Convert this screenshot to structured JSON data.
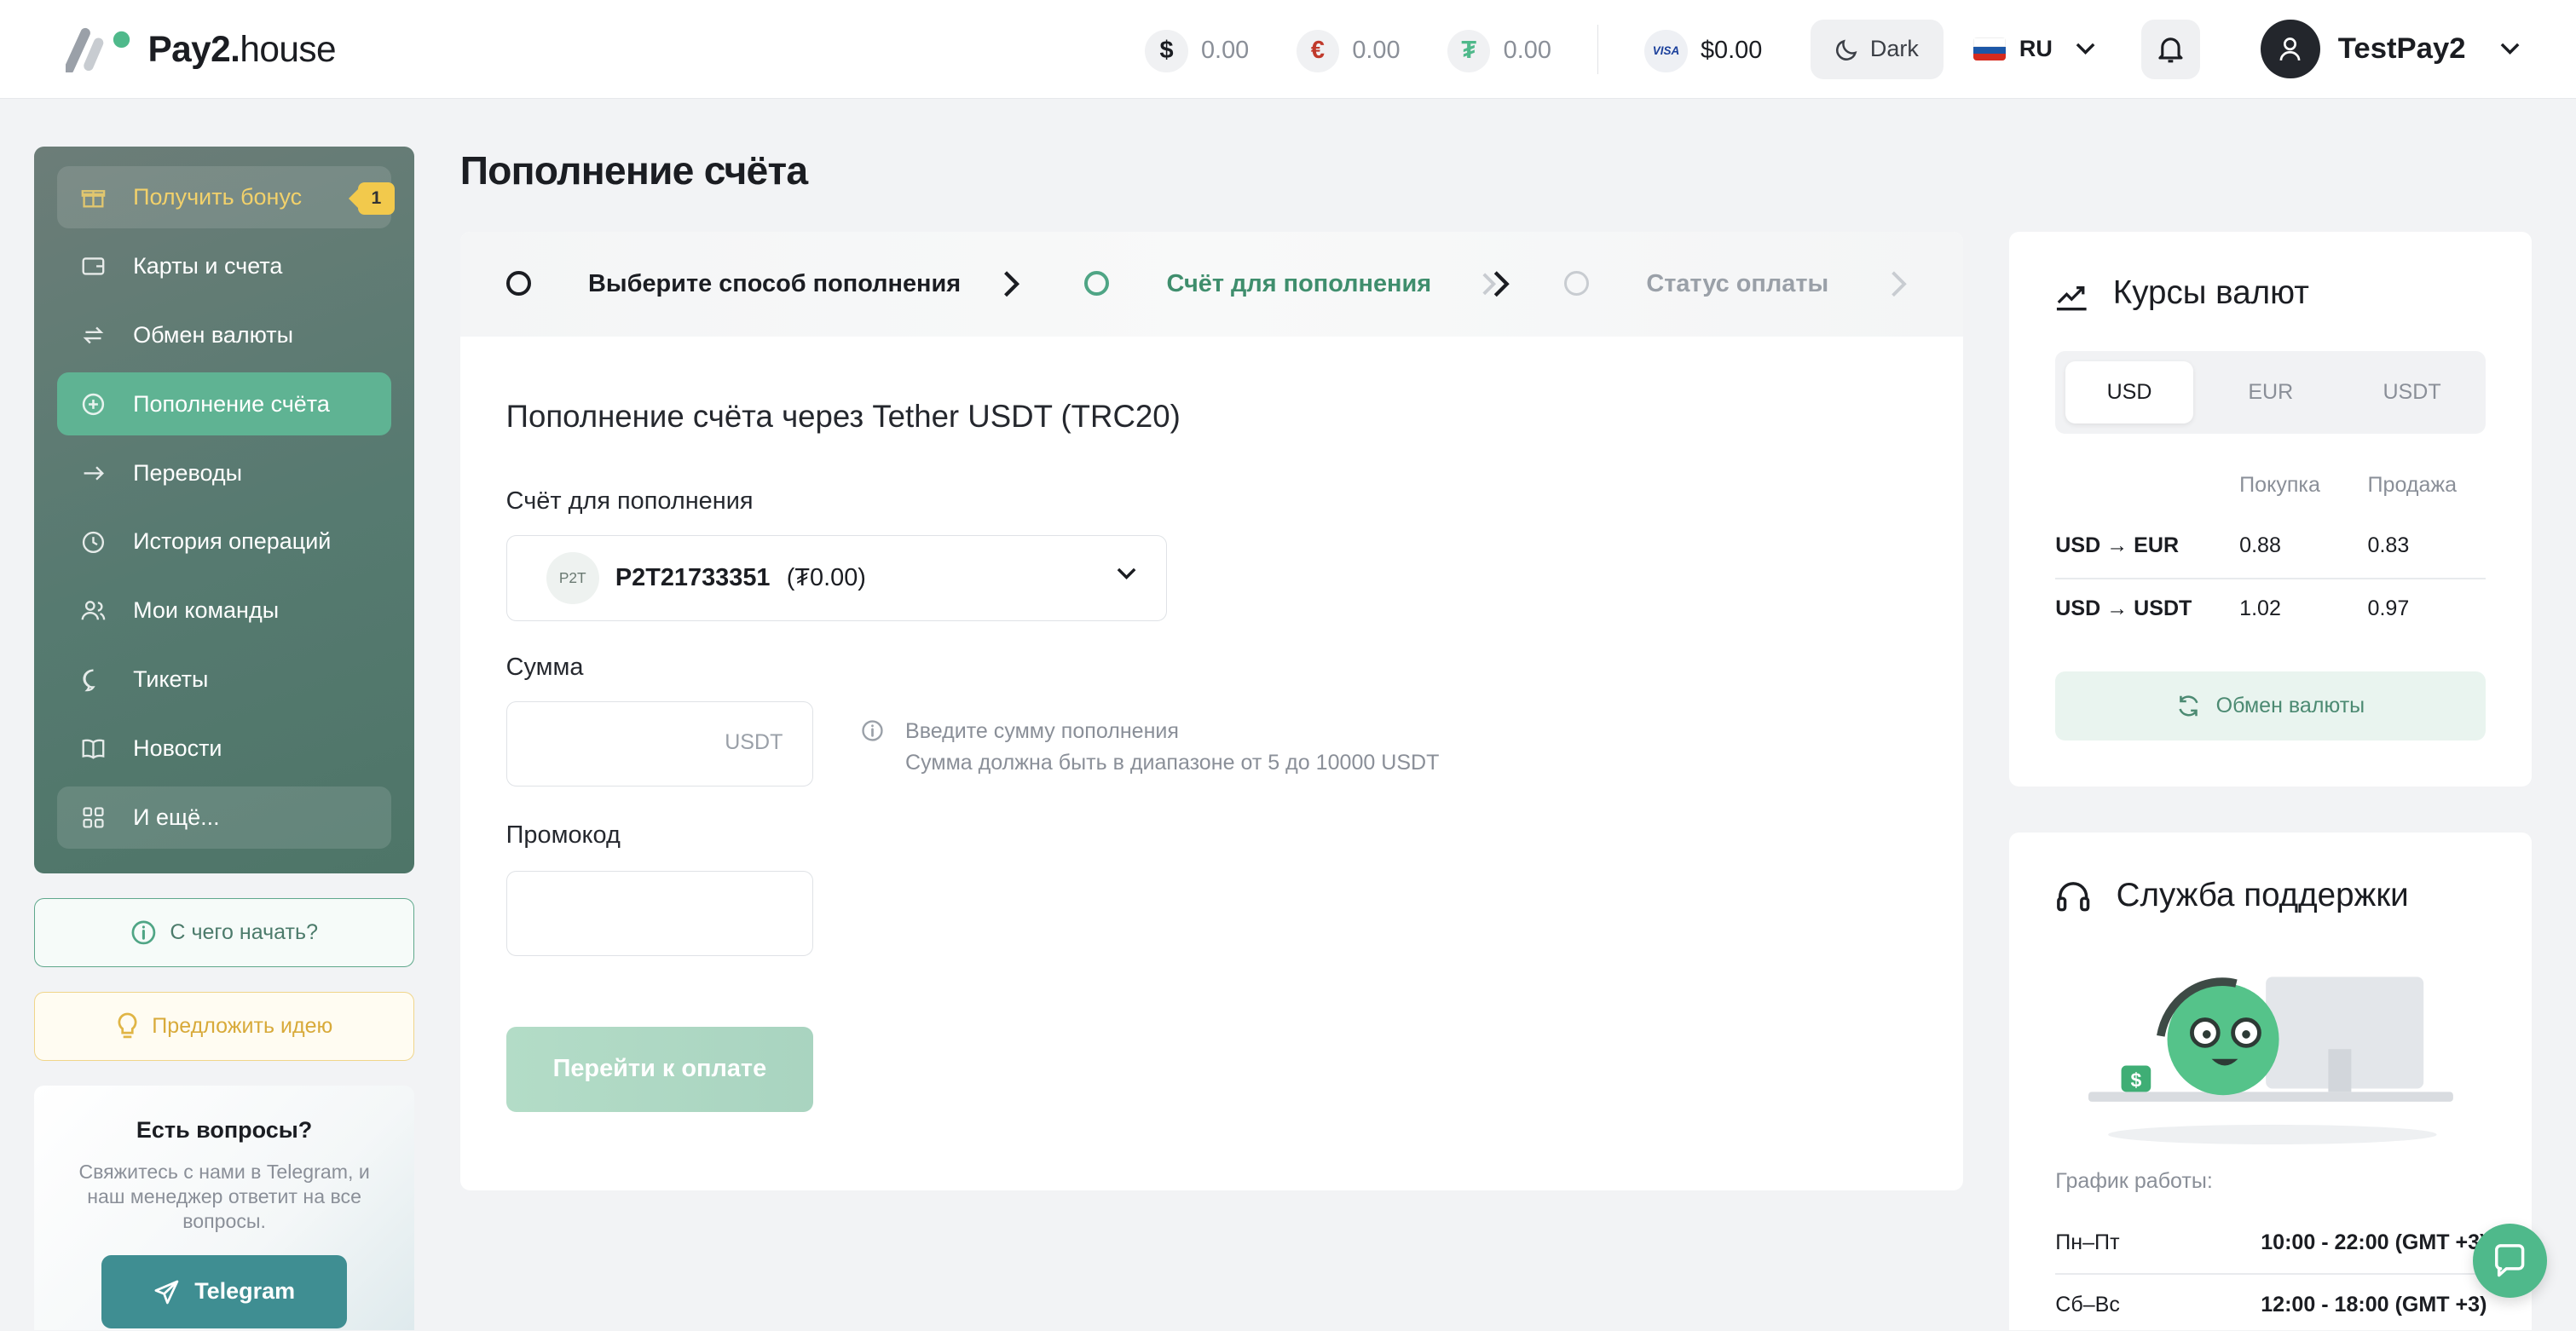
{
  "header": {
    "logo_bold": "Pay2.",
    "logo_light": "house",
    "balances": [
      {
        "symbol": "$",
        "value": "0.00",
        "icon": "dollar-icon",
        "color": "#1b1d22"
      },
      {
        "symbol": "€",
        "value": "0.00",
        "icon": "euro-icon",
        "color": "#c0392b"
      },
      {
        "symbol": "₮",
        "value": "0.00",
        "icon": "tether-icon",
        "color": "#4fb98b"
      }
    ],
    "card_badge": "VISA",
    "card_balance": "$0.00",
    "theme_label": "Dark",
    "language": "RU",
    "user_name": "TestPay2"
  },
  "sidebar": {
    "items": [
      {
        "label": "Получить бонус",
        "icon": "gift-icon",
        "badge": "1"
      },
      {
        "label": "Карты и счета",
        "icon": "wallet-icon"
      },
      {
        "label": "Обмен валюты",
        "icon": "exchange-icon"
      },
      {
        "label": "Пополнение счёта",
        "icon": "plus-circle-icon"
      },
      {
        "label": "Переводы",
        "icon": "arrow-right-icon"
      },
      {
        "label": "История операций",
        "icon": "clock-icon"
      },
      {
        "label": "Мои команды",
        "icon": "users-icon"
      },
      {
        "label": "Тикеты",
        "icon": "chat-icon"
      },
      {
        "label": "Новости",
        "icon": "book-icon"
      },
      {
        "label": "И ещё...",
        "icon": "grid-icon"
      }
    ],
    "start_label": "С чего начать?",
    "idea_label": "Предложить идею",
    "faq_title": "Есть вопросы?",
    "faq_text": "Свяжитесь с нами в Telegram, и наш менеджер ответит на все вопросы.",
    "telegram_label": "Telegram"
  },
  "main": {
    "title": "Пополнение счёта",
    "steps": [
      {
        "label": "Выберите способ пополнения",
        "state": "done"
      },
      {
        "label": "Счёт для пополнения",
        "state": "current"
      },
      {
        "label": "Статус оплаты",
        "state": "pending"
      }
    ],
    "form_title": "Пополнение счёта через Tether USDT (TRC20)",
    "account_label": "Счёт для пополнения",
    "account_badge": "P2T",
    "account_number": "P2T21733351",
    "account_balance": "(₮0.00)",
    "amount_label": "Сумма",
    "amount_value": "",
    "amount_unit": "USDT",
    "hint_line1": "Введите сумму пополнения",
    "hint_line2": "Сумма должна быть в диапазоне от 5 до 10000 USDT",
    "promo_label": "Промокод",
    "promo_value": "",
    "submit_label": "Перейти к оплате"
  },
  "rates": {
    "title": "Курсы валют",
    "tabs": [
      "USD",
      "EUR",
      "USDT"
    ],
    "selected_tab": "USD",
    "col_buy": "Покупка",
    "col_sell": "Продажа",
    "rows": [
      {
        "pair": "USD → EUR",
        "buy": "0.88",
        "sell": "0.83"
      },
      {
        "pair": "USD → USDT",
        "buy": "1.02",
        "sell": "0.97"
      }
    ],
    "exchange_label": "Обмен валюты"
  },
  "support": {
    "title": "Служба поддержки",
    "schedule_label": "График работы:",
    "schedule": [
      {
        "days": "Пн–Пт",
        "hours": "10:00 - 22:00 (GMT +3)"
      },
      {
        "days": "Сб–Вс",
        "hours": "12:00 - 18:00 (GMT +3)"
      }
    ]
  },
  "colors": {
    "accent": "#4fb98b",
    "sidebar": "#567a70",
    "step_current": "#3f8e6d"
  }
}
